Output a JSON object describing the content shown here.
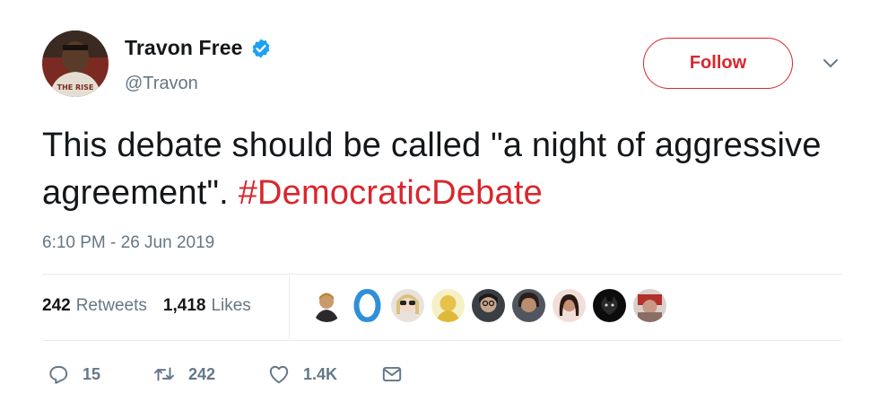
{
  "author": {
    "display_name": "Travon Free",
    "handle": "@Travon",
    "verified_icon": "verified-badge-icon",
    "avatar_text": "THE RISE"
  },
  "follow_button": {
    "label": "Follow"
  },
  "tweet": {
    "text": "This debate should be called \"a night of aggressive agreement\". ",
    "hashtag": "#DemocraticDebate",
    "timestamp": "6:10 PM - 26 Jun 2019"
  },
  "stats": {
    "retweets_count": "242",
    "retweets_label": "Retweets",
    "likes_count": "1,418",
    "likes_label": "Likes"
  },
  "likers": [
    {
      "name": "liker-avatar-1"
    },
    {
      "name": "liker-avatar-2"
    },
    {
      "name": "liker-avatar-3"
    },
    {
      "name": "liker-avatar-4"
    },
    {
      "name": "liker-avatar-5"
    },
    {
      "name": "liker-avatar-6"
    },
    {
      "name": "liker-avatar-7"
    },
    {
      "name": "liker-avatar-8"
    },
    {
      "name": "liker-avatar-9"
    }
  ],
  "actions": {
    "reply_count": "15",
    "retweet_count": "242",
    "like_count": "1.4K"
  },
  "colors": {
    "accent": "#d9262d",
    "verified": "#1da1f2",
    "secondary_text": "#657786",
    "divider": "#e6ecf0"
  }
}
